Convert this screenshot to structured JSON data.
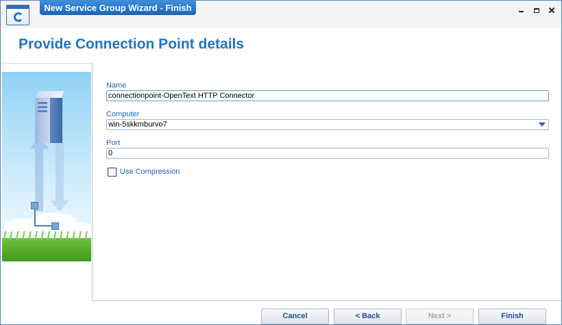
{
  "window": {
    "title": "New Service Group Wizard - Finish"
  },
  "header": {
    "title": "Provide Connection Point details"
  },
  "form": {
    "name_label": "Name",
    "name_value": "connectionpoint-OpenText HTTP Connector",
    "computer_label": "Computer",
    "computer_value": "win-5skkmburvo7",
    "port_label": "Port",
    "port_value": "0",
    "use_compression_label": "Use Compression",
    "use_compression_checked": false
  },
  "buttons": {
    "cancel": "Cancel",
    "back": "< Back",
    "next": "Next >",
    "finish": "Finish"
  },
  "icons": [
    "app-icon",
    "minimize-icon",
    "maximize-icon",
    "close-icon",
    "server-icon",
    "dropdown-arrow-icon"
  ]
}
